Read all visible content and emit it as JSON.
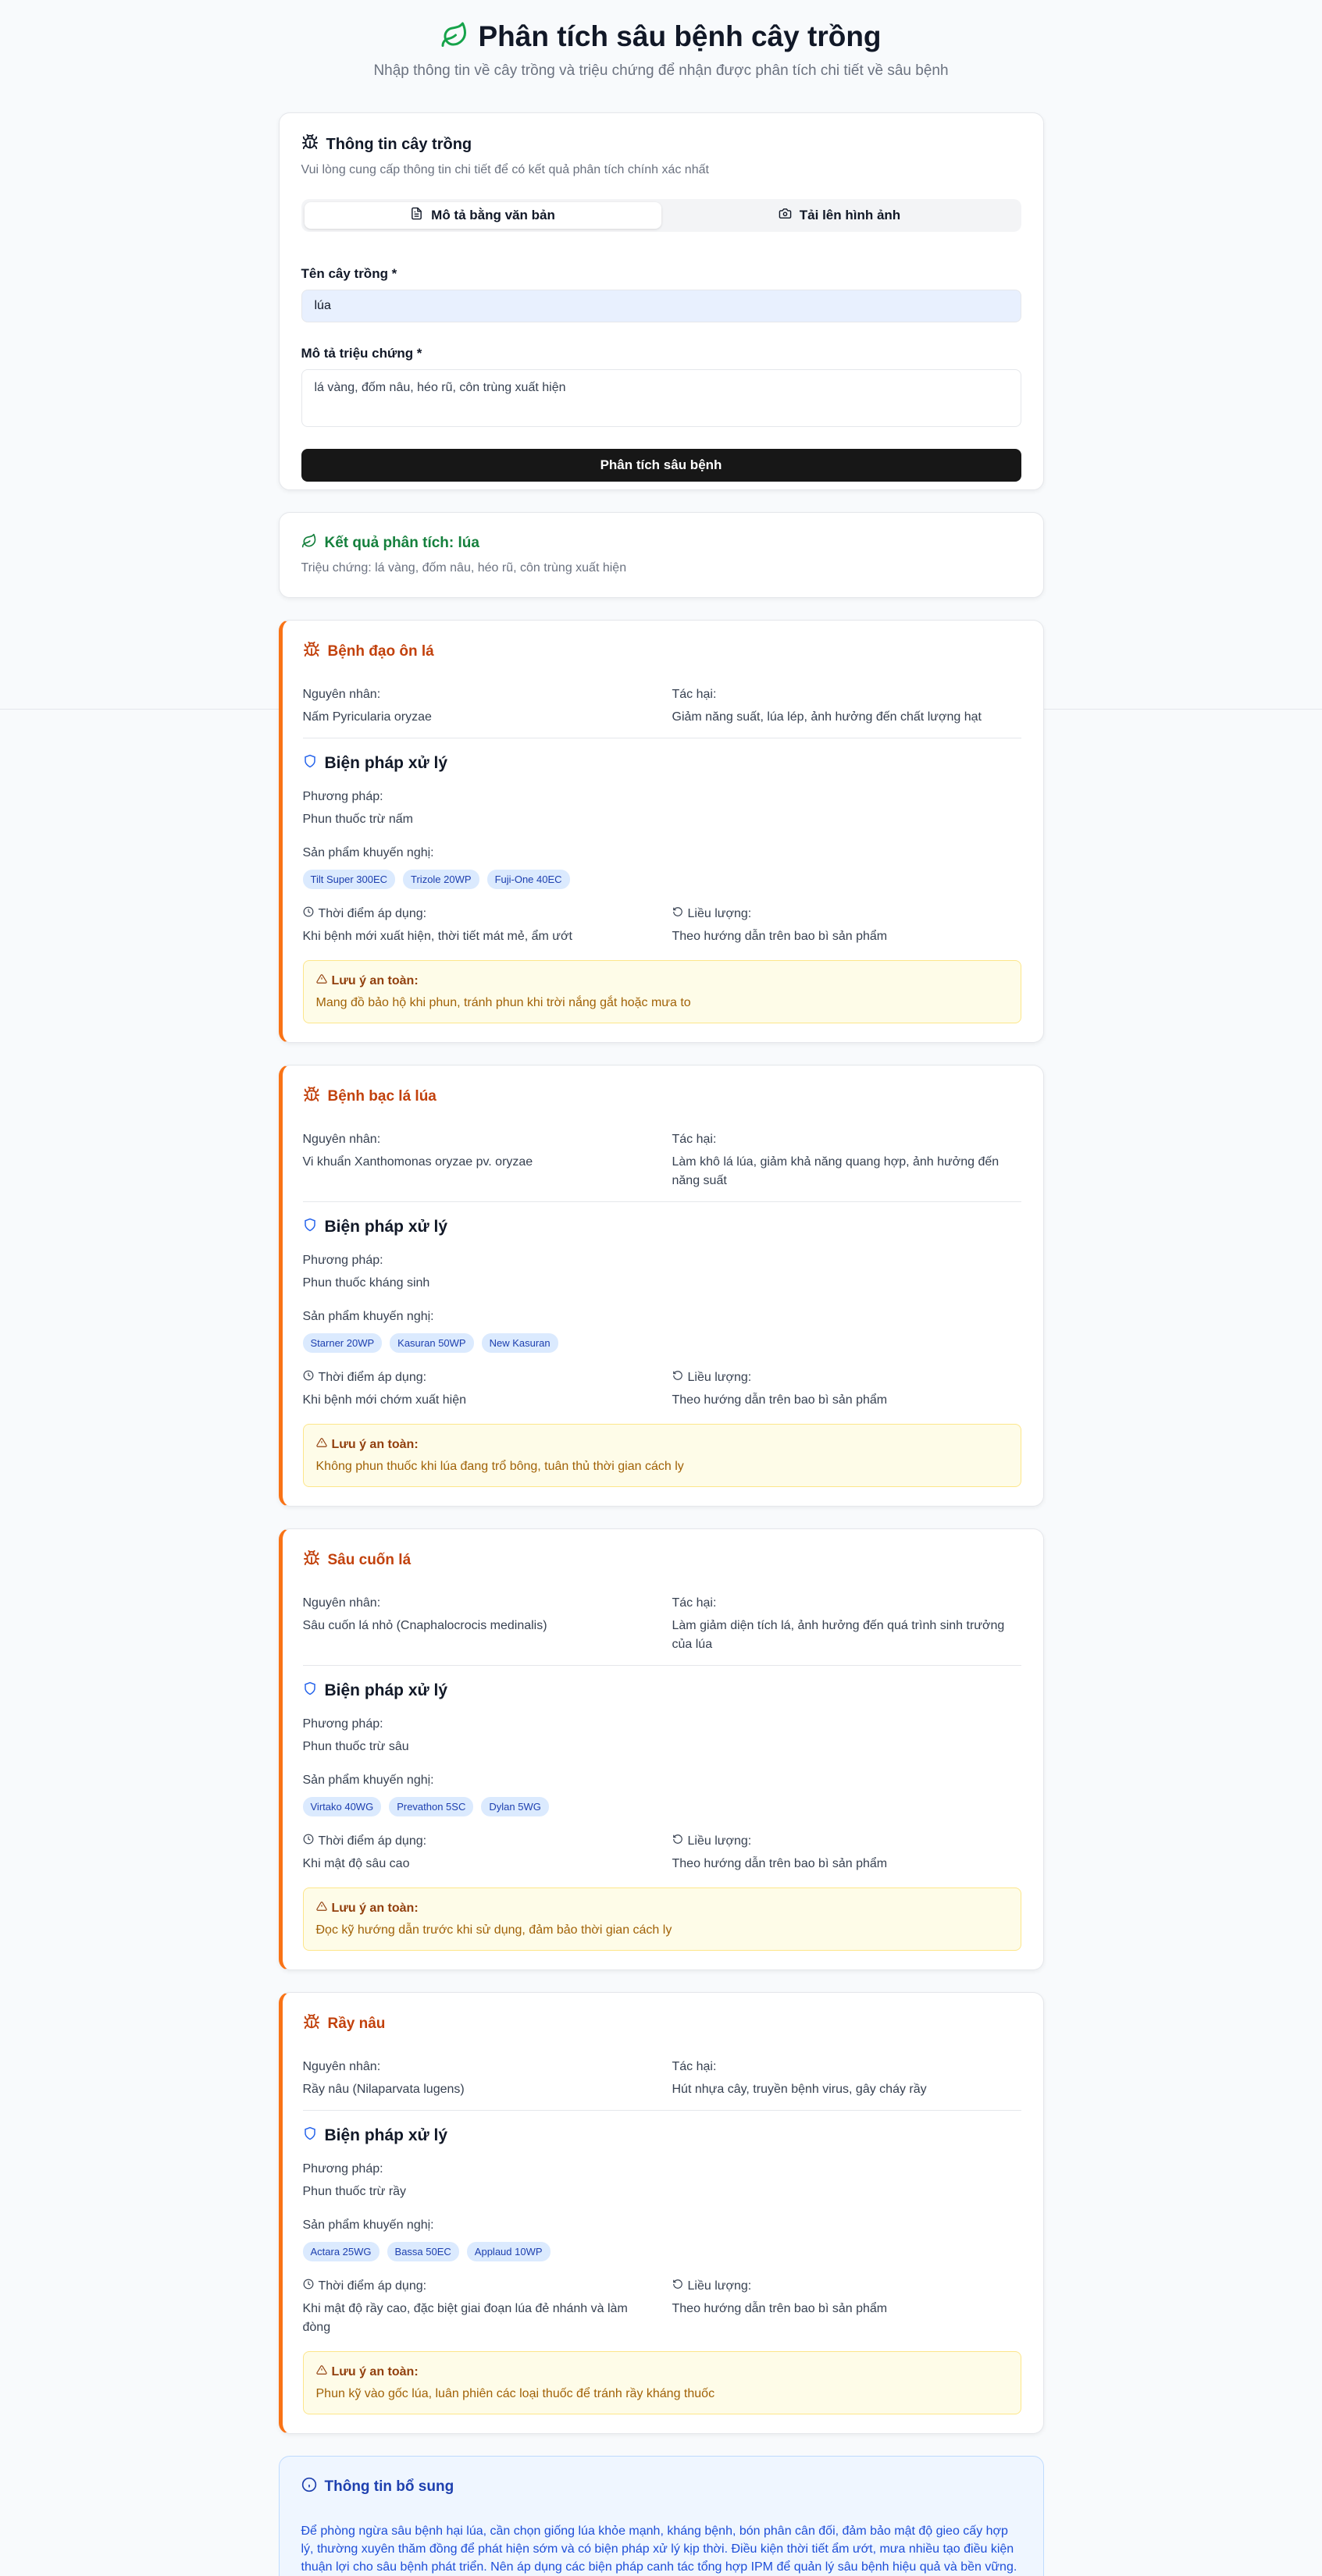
{
  "header": {
    "title": "Phân tích sâu bệnh cây trồng",
    "subtitle": "Nhập thông tin về cây trồng và triệu chứng để nhận được phân tích chi tiết về sâu bệnh"
  },
  "form": {
    "title": "Thông tin cây trồng",
    "subtitle": "Vui lòng cung cấp thông tin chi tiết để có kết quả phân tích chính xác nhất",
    "tabs": [
      {
        "label": "Mô tả bằng văn bản"
      },
      {
        "label": "Tải lên hình ảnh"
      }
    ],
    "crop_label": "Tên cây trồng *",
    "crop_value": "lúa",
    "symptom_label": "Mô tả triệu chứng *",
    "symptom_value": "lá vàng, đốm nâu, héo rũ, côn trùng xuất hiện",
    "submit_label": "Phân tích sâu bệnh"
  },
  "result": {
    "title": "Kết quả phân tích: lúa",
    "subtitle": "Triệu chứng: lá vàng, đốm nâu, héo rũ, côn trùng xuất hiện"
  },
  "labels": {
    "cause": "Nguyên nhân:",
    "harm": "Tác hại:",
    "treatment": "Biện pháp xử lý",
    "method": "Phương pháp:",
    "products": "Sản phẩm khuyến nghị:",
    "timing": "Thời điểm áp dụng:",
    "dosage": "Liều lượng:",
    "safety": "Lưu ý an toàn:"
  },
  "pests": [
    {
      "name": "Bệnh đạo ôn lá",
      "cause": "Nấm Pyricularia oryzae",
      "harm": "Giảm năng suất, lúa lép, ảnh hưởng đến chất lượng hạt",
      "method": "Phun thuốc trừ nấm",
      "products": [
        "Tilt Super 300EC",
        "Trizole 20WP",
        "Fuji-One 40EC"
      ],
      "timing": "Khi bệnh mới xuất hiện, thời tiết mát mẻ, ẩm ướt",
      "dosage": "Theo hướng dẫn trên bao bì sản phẩm",
      "safety": "Mang đồ bảo hộ khi phun, tránh phun khi trời nắng gắt hoặc mưa to"
    },
    {
      "name": "Bệnh bạc lá lúa",
      "cause": "Vi khuẩn Xanthomonas oryzae pv. oryzae",
      "harm": "Làm khô lá lúa, giảm khả năng quang hợp, ảnh hưởng đến năng suất",
      "method": "Phun thuốc kháng sinh",
      "products": [
        "Starner 20WP",
        "Kasuran 50WP",
        "New Kasuran"
      ],
      "timing": "Khi bệnh mới chớm xuất hiện",
      "dosage": "Theo hướng dẫn trên bao bì sản phẩm",
      "safety": "Không phun thuốc khi lúa đang trổ bông, tuân thủ thời gian cách ly"
    },
    {
      "name": "Sâu cuốn lá",
      "cause": "Sâu cuốn lá nhỏ (Cnaphalocrocis medinalis)",
      "harm": "Làm giảm diện tích lá, ảnh hưởng đến quá trình sinh trưởng của lúa",
      "method": "Phun thuốc trừ sâu",
      "products": [
        "Virtako 40WG",
        "Prevathon 5SC",
        "Dylan 5WG"
      ],
      "timing": "Khi mật độ sâu cao",
      "dosage": "Theo hướng dẫn trên bao bì sản phẩm",
      "safety": "Đọc kỹ hướng dẫn trước khi sử dụng, đảm bảo thời gian cách ly"
    },
    {
      "name": "Rầy nâu",
      "cause": "Rầy nâu (Nilaparvata lugens)",
      "harm": "Hút nhựa cây, truyền bệnh virus, gây cháy rầy",
      "method": "Phun thuốc trừ rầy",
      "products": [
        "Actara 25WG",
        "Bassa 50EC",
        "Applaud 10WP"
      ],
      "timing": "Khi mật độ rầy cao, đặc biệt giai đoạn lúa đẻ nhánh và làm đòng",
      "dosage": "Theo hướng dẫn trên bao bì sản phẩm",
      "safety": "Phun kỹ vào gốc lúa, luân phiên các loại thuốc để tránh rầy kháng thuốc"
    }
  ],
  "info": {
    "title": "Thông tin bổ sung",
    "text": "Để phòng ngừa sâu bệnh hại lúa, cần chọn giống lúa khỏe mạnh, kháng bệnh, bón phân cân đối, đảm bảo mật độ gieo cấy hợp lý, thường xuyên thăm đồng để phát hiện sớm và có biện pháp xử lý kịp thời. Điều kiện thời tiết ẩm ướt, mưa nhiều tạo điều kiện thuận lợi cho sâu bệnh phát triển. Nên áp dụng các biện pháp canh tác tổng hợp IPM để quản lý sâu bệnh hiệu quả và bền vững."
  },
  "colors": {
    "accent": "#f97316",
    "primary": "#171717",
    "success": "#15803d",
    "info": "#1e40af"
  }
}
